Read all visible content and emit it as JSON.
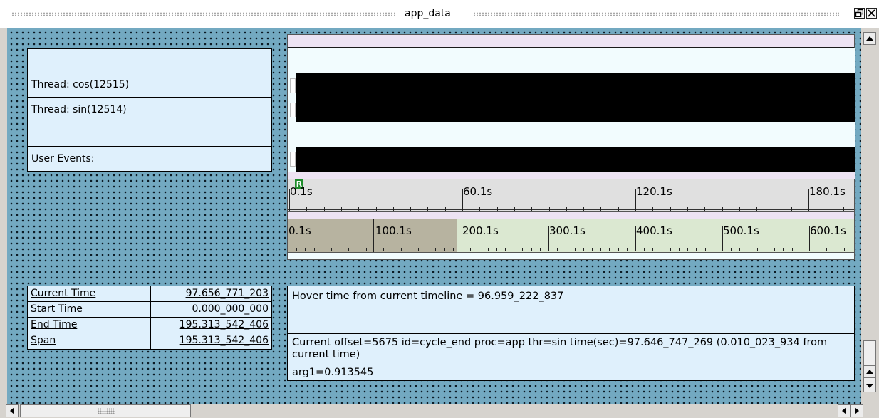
{
  "window": {
    "title": "app_data",
    "float_icon": "float-icon",
    "close_icon": "close-icon"
  },
  "threads": [
    {
      "label": ""
    },
    {
      "label": "Thread: cos(12515)"
    },
    {
      "label": "Thread: sin(12514)"
    },
    {
      "label": ""
    },
    {
      "label": "User Events:"
    }
  ],
  "timeline": {
    "marker_label": "R",
    "ruler_labels": [
      "0.1s",
      "60.1s",
      "120.1s",
      "180.1s"
    ],
    "overview_labels": [
      "0.1s",
      "100.1s",
      "200.1s",
      "300.1s",
      "400.1s",
      "500.1s",
      "600.1s"
    ]
  },
  "times": [
    {
      "name": "Current Time",
      "value": "97.656_771_203"
    },
    {
      "name": "Start Time",
      "value": "0.000_000_000"
    },
    {
      "name": "End Time",
      "value": "195.313_542_406"
    },
    {
      "name": "Span",
      "value": "195.313_542_406"
    }
  ],
  "info": {
    "hover": "Hover time from current timeline = 96.959_222_837",
    "event": "Current offset=5675  id=cycle_end  proc=app  thr=sin  time(sec)=97.646_747_269   (0.010_023_934 from current time)",
    "arg": "arg1=0.913545"
  },
  "colors": {
    "canvas": "#73a9c1",
    "panel": "#dff0fc",
    "lane": "#f2fcfe",
    "band": "#ede3f3",
    "marker": "#1f8d2c",
    "overview": "#dbe8d1",
    "selection": "#b7b3a0"
  }
}
